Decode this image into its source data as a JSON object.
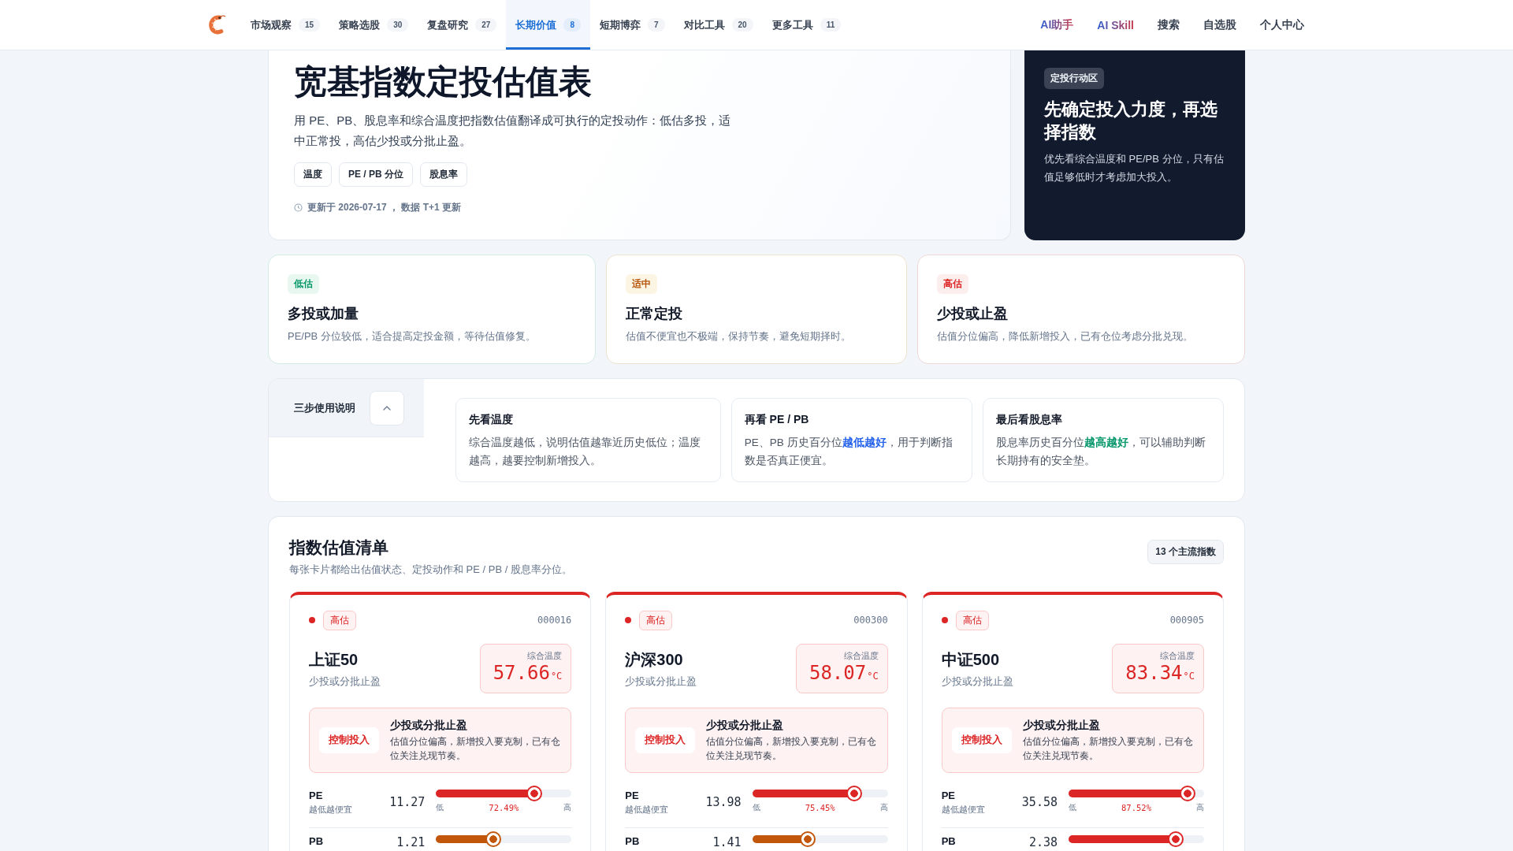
{
  "nav": {
    "items": [
      {
        "label": "市场观察",
        "count": "15",
        "selected": false
      },
      {
        "label": "策略选股",
        "count": "30",
        "selected": false
      },
      {
        "label": "复盘研究",
        "count": "27",
        "selected": false
      },
      {
        "label": "长期价值",
        "count": "8",
        "selected": true
      },
      {
        "label": "短期博弈",
        "count": "7",
        "selected": false
      },
      {
        "label": "对比工具",
        "count": "20",
        "selected": false
      },
      {
        "label": "更多工具",
        "count": "11",
        "selected": false
      }
    ],
    "links": [
      {
        "label": "AI助手",
        "kind": "gradient"
      },
      {
        "label": "AI Skill",
        "kind": "gradient"
      },
      {
        "label": "搜索",
        "kind": "plain"
      },
      {
        "label": "自选股",
        "kind": "plain"
      },
      {
        "label": "个人中心",
        "kind": "plain"
      }
    ]
  },
  "hero": {
    "title": "宽基指数定投估值表",
    "description": "用 PE、PB、股息率和综合温度把指数估值翻译成可执行的定投动作：低估多投，适中正常投，高估少投或分批止盈。",
    "tags": [
      "温度",
      "PE / PB 分位",
      "股息率"
    ],
    "updated": "更新于 2026-07-17 ， 数据 T+1 更新"
  },
  "action_panel": {
    "badge": "定投行动区",
    "title": "先确定投入力度，再选择指数",
    "text": "优先看综合温度和 PE/PB 分位，只有估值足够低时才考虑加大投入。"
  },
  "zones": [
    {
      "kind": "low",
      "tag": "低估",
      "title": "多投或加量",
      "text": "PE/PB 分位较低，适合提高定投金额，等待估值修复。"
    },
    {
      "kind": "mid",
      "tag": "适中",
      "title": "正常定投",
      "text": "估值不便宜也不极端，保持节奏，避免短期择时。"
    },
    {
      "kind": "high",
      "tag": "高估",
      "title": "少投或止盈",
      "text": "估值分位偏高，降低新增投入，已有仓位考虑分批兑现。"
    }
  ],
  "guide": {
    "title": "三步使用说明",
    "expanded": true,
    "steps": [
      {
        "title": "先看温度",
        "text": "综合温度越低，说明估值越靠近历史低位；温度越高，越要控制新增投入。"
      },
      {
        "title": "再看 PE / PB",
        "text": "PE、PB 历史百分位**越低越好**，用于判断指数是否真正便宜。",
        "color": "#2563eb"
      },
      {
        "title": "最后看股息率",
        "text": "股息率历史百分位**越高越好**，可以辅助判断长期持有的安全垫。",
        "color": "#059669"
      }
    ]
  },
  "list": {
    "title": "指数估值清单",
    "subtitle": "每张卡片都给出估值状态、定投动作和 PE / PB / 股息率分位。",
    "count": "13 个主流指数",
    "cards": [
      {
        "kind": "high",
        "tag": "高估",
        "code": "000016",
        "name": "上证50",
        "action": "少投或分批止盈",
        "temperature_label": "综合温度",
        "temperature": "57.66",
        "unit": "°C",
        "advice": {
          "tag": "控制投入",
          "title": "少投或分批止盈",
          "text": "估值分位偏高，新增投入要克制，已有仓位关注兑现节奏。"
        },
        "metrics": [
          {
            "name": "PE",
            "hint": "越低越便宜",
            "value": "11.27",
            "level": 0.7249,
            "color": "#dc2626",
            "low_label": "低",
            "percent": "72.49%",
            "high_label": "高"
          },
          {
            "name": "PB",
            "value": "1.21",
            "level": 0.42,
            "color": "#c2570c"
          }
        ]
      },
      {
        "kind": "high",
        "tag": "高估",
        "code": "000300",
        "name": "沪深300",
        "action": "少投或分批止盈",
        "temperature_label": "综合温度",
        "temperature": "58.07",
        "unit": "°C",
        "advice": {
          "tag": "控制投入",
          "title": "少投或分批止盈",
          "text": "估值分位偏高，新增投入要克制，已有仓位关注兑现节奏。"
        },
        "metrics": [
          {
            "name": "PE",
            "hint": "越低越便宜",
            "value": "13.98",
            "level": 0.7545,
            "color": "#dc2626",
            "low_label": "低",
            "percent": "75.45%",
            "high_label": "高"
          },
          {
            "name": "PB",
            "value": "1.41",
            "level": 0.41,
            "color": "#c2570c"
          }
        ]
      },
      {
        "kind": "high",
        "tag": "高估",
        "code": "000905",
        "name": "中证500",
        "action": "少投或分批止盈",
        "temperature_label": "综合温度",
        "temperature": "83.34",
        "unit": "°C",
        "advice": {
          "tag": "控制投入",
          "title": "少投或分批止盈",
          "text": "估值分位偏高，新增投入要克制，已有仓位关注兑现节奏。"
        },
        "metrics": [
          {
            "name": "PE",
            "hint": "越低越便宜",
            "value": "35.58",
            "level": 0.8752,
            "color": "#dc2626",
            "low_label": "低",
            "percent": "87.52%",
            "high_label": "高"
          },
          {
            "name": "PB",
            "value": "2.38",
            "level": 0.79,
            "color": "#dc2626"
          }
        ]
      }
    ]
  }
}
